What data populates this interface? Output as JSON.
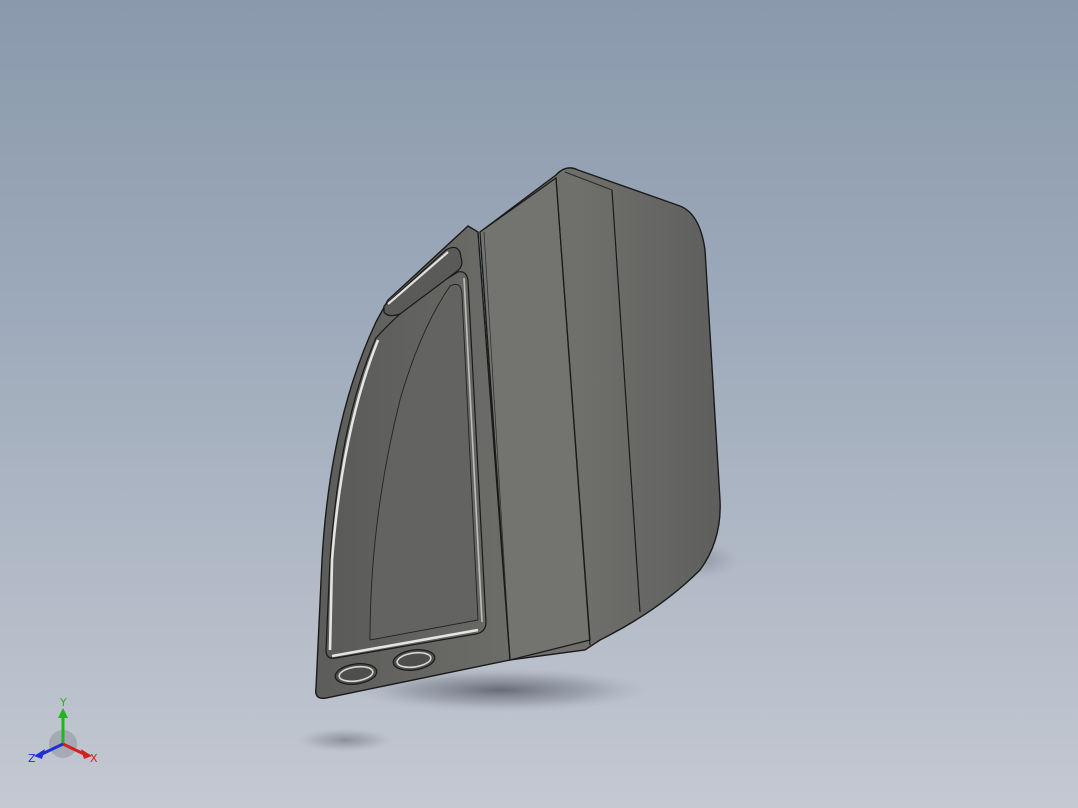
{
  "viewport": {
    "background_top": "#8a99ac",
    "background_bottom": "#c4c9d2"
  },
  "model": {
    "icon": "3d-part-model",
    "body_color": "#6b6c69",
    "face_light_color": "#797a75",
    "face_dark_color": "#5f605e",
    "edge_color": "#1a1a1a",
    "highlight_color": "#d8d8d8"
  },
  "triad": {
    "x_label": "X",
    "y_label": "Y",
    "z_label": "Z",
    "x_color": "#d42020",
    "y_color": "#22b422",
    "z_color": "#2030d8"
  }
}
